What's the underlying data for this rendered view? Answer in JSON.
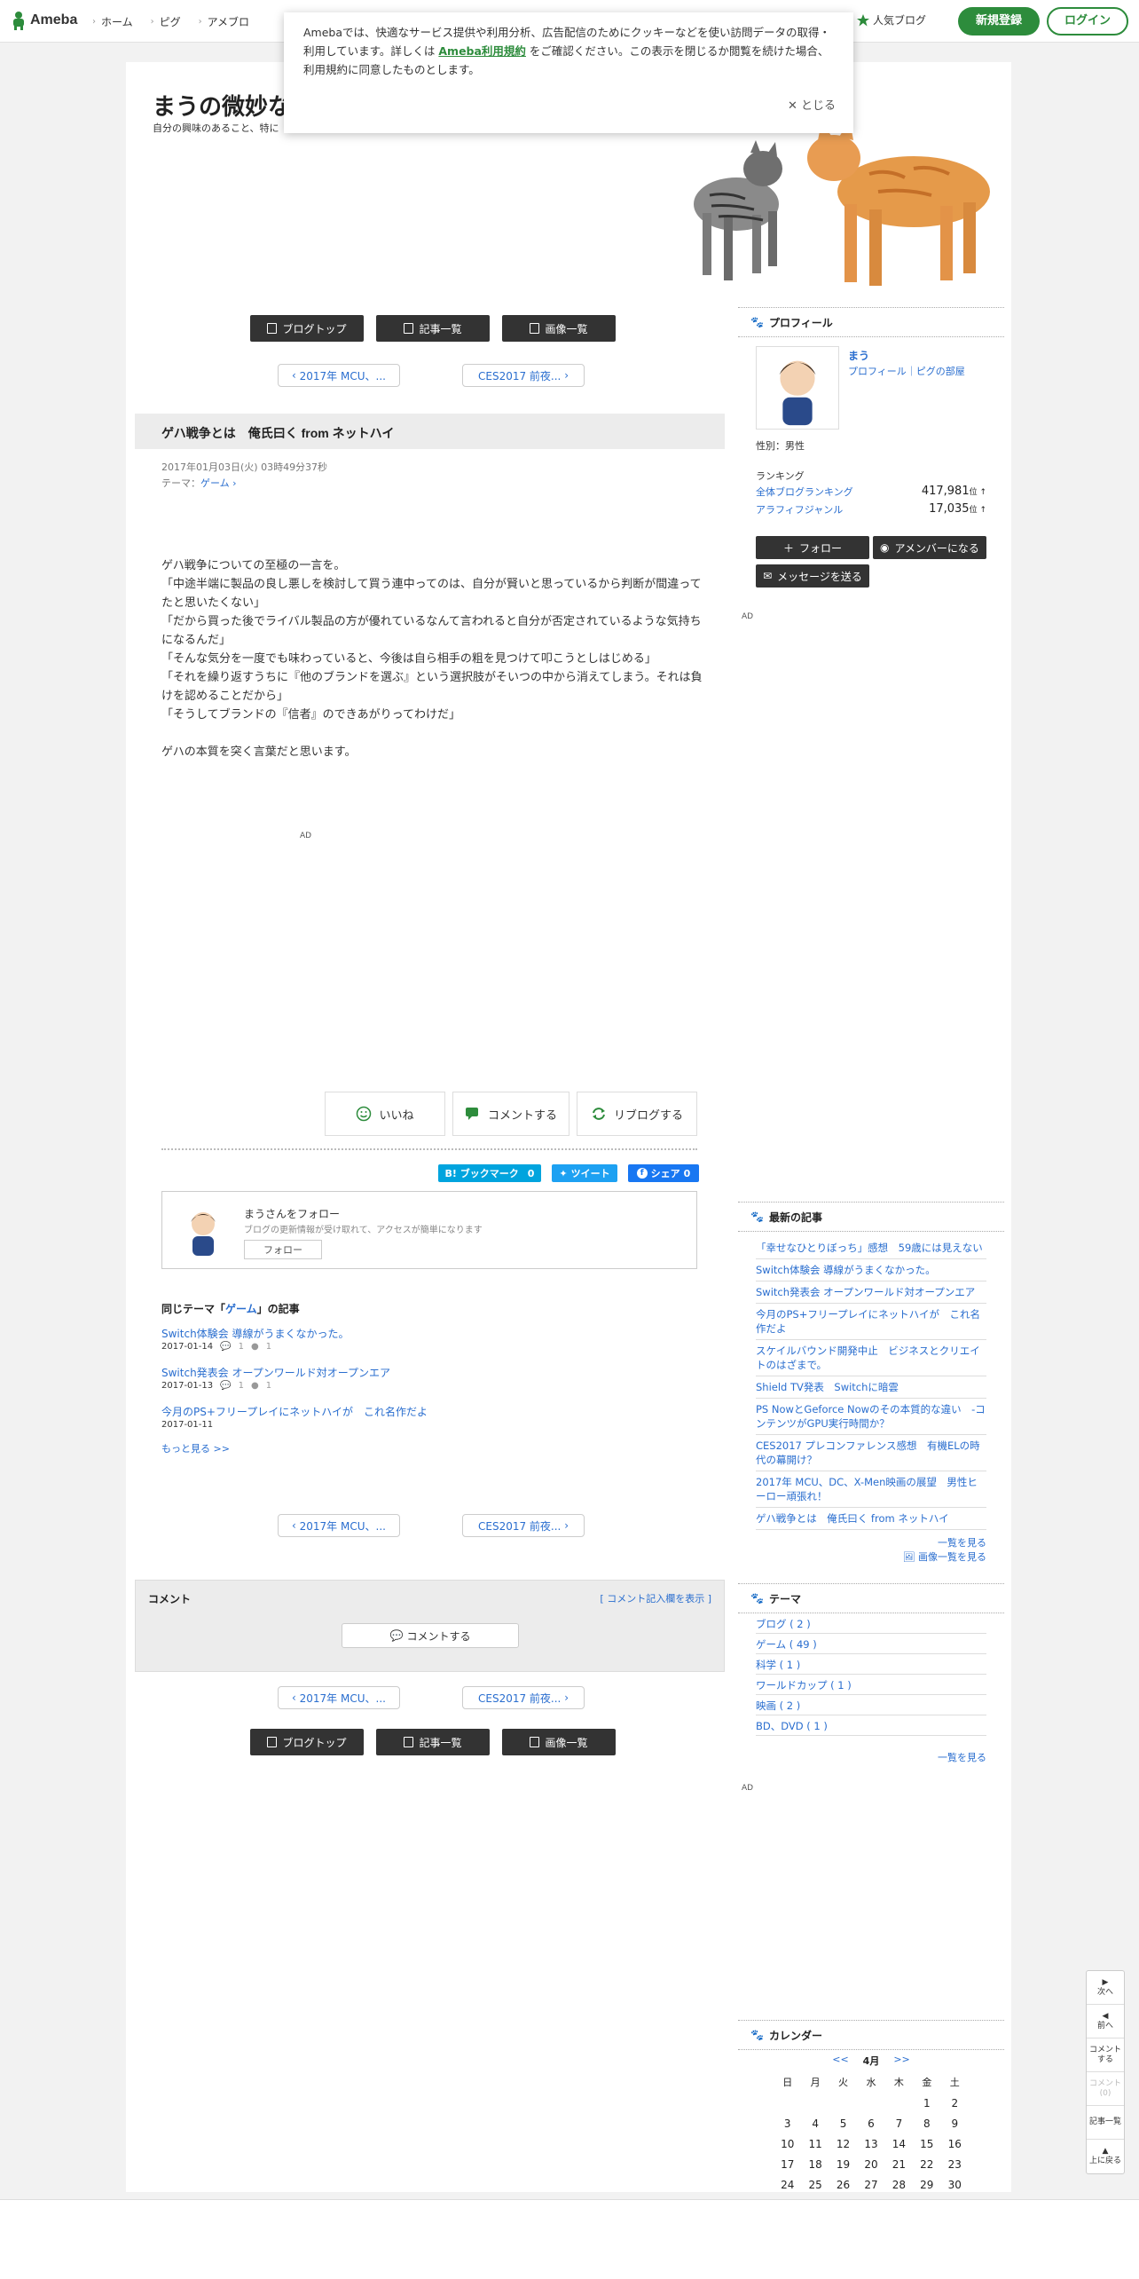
{
  "header": {
    "logo": "Ameba",
    "nav": [
      "ホーム",
      "ピグ",
      "アメブロ"
    ],
    "popular": "人気ブログ",
    "register": "新規登録",
    "login": "ログイン"
  },
  "cookie": {
    "text1": "Amebaでは、快適なサービス提供や利用分析、広告配信のためにクッキーなどを使い訪問データの取得・利用しています。詳しくは",
    "link": "Ameba利用規約",
    "text2": "をご確認ください。この表示を閉じるか閲覧を続けた場合、利用規約に同意したものとします。",
    "close": "✕ とじる"
  },
  "blog": {
    "title": "まうの微妙な",
    "desc": "自分の興味のあること、特に"
  },
  "nav_buttons": [
    "ブログトップ",
    "記事一覧",
    "画像一覧"
  ],
  "pager": {
    "prev": "2017年 MCU、...",
    "next": "CES2017 前夜..."
  },
  "entry": {
    "title": "ゲハ戦争とは　俺氏曰く from ネットハイ",
    "date": "2017年01月03日(火) 03時49分37秒",
    "theme_label": "テーマ：",
    "theme": "ゲーム",
    "body": [
      "ゲハ戦争についての至極の一言を。",
      "「中途半端に製品の良し悪しを検討して買う連中ってのは、自分が賢いと思っているから判断が間違ってたと思いたくない」",
      "「だから買った後でライバル製品の方が優れているなんて言われると自分が否定されているような気持ちになるんだ」",
      "「そんな気分を一度でも味わっていると、今後は自ら相手の粗を見つけて叩こうとしはじめる」",
      "「それを繰り返すうちに『他のブランドを選ぶ』という選択肢がそいつの中から消えてしまう。それは負けを認めることだから」",
      "「そうしてブランドの『信者』のできあがりってわけだ」",
      "",
      "ゲハの本質を突く言葉だと思います。"
    ]
  },
  "ad_label": "AD",
  "reactions": [
    "いいね",
    "コメントする",
    "リブログする"
  ],
  "shares": {
    "hatena": "B! ブックマーク",
    "hatena_count": "0",
    "tweet": "ツイート",
    "fb": "シェア",
    "fb_count": "0"
  },
  "followbox": {
    "title": "まうさんをフォロー",
    "desc": "ブログの更新情報が受け取れて、アクセスが簡単になります",
    "button": "フォロー"
  },
  "related": {
    "prefix": "同じテーマ「",
    "theme": "ゲーム",
    "suffix": "」の記事",
    "items": [
      {
        "title": "Switch体験会 導線がうまくなかった。",
        "date": "2017-01-14",
        "comments": "1",
        "reblogs": "1"
      },
      {
        "title": "Switch発表会 オープンワールド対オープンエア",
        "date": "2017-01-13",
        "comments": "1",
        "reblogs": "1"
      },
      {
        "title": "今月のPS+フリープレイにネットハイが　これ名作だよ",
        "date": "2017-01-11",
        "comments": "",
        "reblogs": ""
      }
    ],
    "more": "もっと見る >>"
  },
  "comments": {
    "title": "コメント",
    "show": "[ コメント記入欄を表示 ]",
    "button": "コメントする"
  },
  "profile": {
    "heading": "プロフィール",
    "name": "まう",
    "links": "プロフィール｜ピグの部屋",
    "sex": "性別：男性",
    "ranking": "ランキング",
    "rank_all_label": "全体ブログランキング",
    "rank_all": "417,981",
    "rank_genre_label": "アラフィフジャンル",
    "rank_genre": "17,035",
    "rank_unit": "位 ↑",
    "follow": "フォロー",
    "member": "アメンバーになる",
    "message": "メッセージを送る"
  },
  "latest": {
    "heading": "最新の記事",
    "items": [
      "「幸せなひとりぼっち」感想　59歳には見えない",
      "Switch体験会 導線がうまくなかった。",
      "Switch発表会 オープンワールド対オープンエア",
      "今月のPS+フリープレイにネットハイが　これ名作だよ",
      "スケイルバウンド開発中止　ビジネスとクリエイトのはざまで。",
      "Shield TV発表　Switchに暗雲",
      "PS NowとGeforce Nowのその本質的な違い　-コンテンツがGPU実行時間か？",
      "CES2017 プレコンファレンス感想　有機ELの時代の幕開け？",
      "2017年 MCU、DC、X-Men映画の展望　男性ヒーロー頑張れ！",
      "ゲハ戦争とは　俺氏曰く from ネットハイ"
    ],
    "list_all": "一覧を見る",
    "image_all": "画像一覧を見る"
  },
  "themes": {
    "heading": "テーマ",
    "items": [
      "ブログ ( 2 )",
      "ゲーム ( 49 )",
      "科学 ( 1 )",
      "ワールドカップ ( 1 )",
      "映画 ( 2 )",
      "BD、DVD ( 1 )"
    ],
    "list_all": "一覧を見る"
  },
  "calendar": {
    "heading": "カレンダー",
    "prev": "<<",
    "month": "4月",
    "next": ">>",
    "weekdays": [
      "日",
      "月",
      "火",
      "水",
      "木",
      "金",
      "土"
    ],
    "weeks": [
      [
        "",
        "",
        "",
        "",
        "",
        "1",
        "2"
      ],
      [
        "3",
        "4",
        "5",
        "6",
        "7",
        "8",
        "9"
      ],
      [
        "10",
        "11",
        "12",
        "13",
        "14",
        "15",
        "16"
      ],
      [
        "17",
        "18",
        "19",
        "20",
        "21",
        "22",
        "23"
      ],
      [
        "24",
        "25",
        "26",
        "27",
        "28",
        "29",
        "30"
      ]
    ]
  },
  "side_nav": [
    "次へ",
    "前へ",
    "コメントする",
    "コメント(0)",
    "記事一覧",
    "上に戻る"
  ],
  "colors": {
    "brand": "#2d8c3c",
    "link": "#2a6ecf",
    "dark_button": "#333333"
  }
}
